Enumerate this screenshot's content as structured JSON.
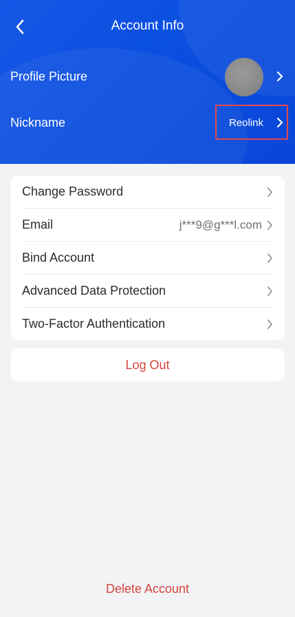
{
  "header": {
    "title": "Account Info",
    "back_icon": "chevron-left-icon"
  },
  "profile": {
    "picture_label": "Profile Picture",
    "nickname_label": "Nickname",
    "nickname_value": "Reolink"
  },
  "account_list": {
    "items": [
      {
        "label": "Change Password",
        "value": ""
      },
      {
        "label": "Email",
        "value": "j***9@g***l.com"
      },
      {
        "label": "Bind Account",
        "value": ""
      },
      {
        "label": "Advanced Data Protection",
        "value": ""
      },
      {
        "label": "Two-Factor Authentication",
        "value": ""
      }
    ]
  },
  "actions": {
    "logout_label": "Log Out",
    "delete_label": "Delete Account"
  },
  "colors": {
    "header_blue": "#0b4fe0",
    "danger_red": "#d2453d",
    "highlight_red": "#e5484d",
    "background": "#f2f3f5"
  }
}
